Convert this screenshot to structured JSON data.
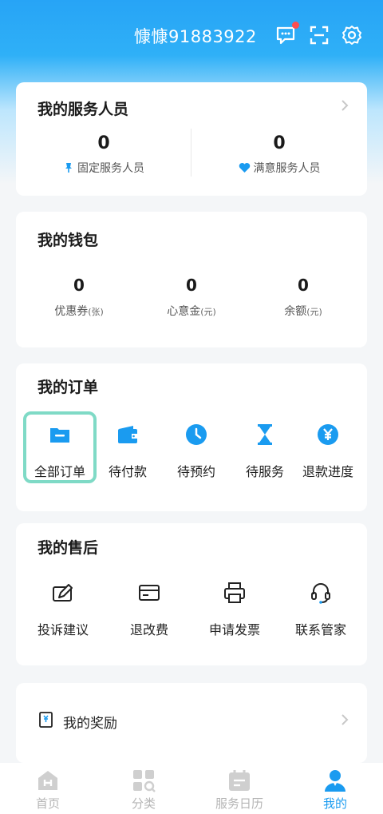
{
  "header": {
    "username": "慷慷91883922",
    "icons": [
      "message-icon",
      "scan-icon",
      "gear-icon"
    ],
    "notification_dot": true,
    "brand_color": "#27a4f6"
  },
  "service_staff": {
    "title": "我的服务人员",
    "items": [
      {
        "value": "0",
        "label": "固定服务人员",
        "icon": "pin-icon"
      },
      {
        "value": "0",
        "label": "满意服务人员",
        "icon": "heart-icon"
      }
    ]
  },
  "wallet": {
    "title": "我的钱包",
    "items": [
      {
        "value": "0",
        "label": "优惠券",
        "unit": "(张)"
      },
      {
        "value": "0",
        "label": "心意金",
        "unit": "(元)"
      },
      {
        "value": "0",
        "label": "余额",
        "unit": "(元)"
      }
    ]
  },
  "orders": {
    "title": "我的订单",
    "items": [
      {
        "label": "全部订单",
        "icon": "folder-icon",
        "selected": true
      },
      {
        "label": "待付款",
        "icon": "wallet-icon"
      },
      {
        "label": "待预约",
        "icon": "clock-icon"
      },
      {
        "label": "待服务",
        "icon": "hourglass-icon"
      },
      {
        "label": "退款进度",
        "icon": "yen-icon"
      }
    ]
  },
  "after_sales": {
    "title": "我的售后",
    "items": [
      {
        "label": "投诉建议",
        "icon": "edit-icon"
      },
      {
        "label": "退改费",
        "icon": "card-icon"
      },
      {
        "label": "申请发票",
        "icon": "printer-icon"
      },
      {
        "label": "联系管家",
        "icon": "headset-icon"
      }
    ]
  },
  "reward": {
    "label": "我的奖励",
    "icon": "receipt-icon"
  },
  "bottom_nav": {
    "items": [
      {
        "label": "首页",
        "icon": "home-icon"
      },
      {
        "label": "分类",
        "icon": "category-icon"
      },
      {
        "label": "服务日历",
        "icon": "calendar-icon"
      },
      {
        "label": "我的",
        "icon": "user-icon",
        "active": true
      }
    ],
    "active_color": "#1a9bf0"
  }
}
